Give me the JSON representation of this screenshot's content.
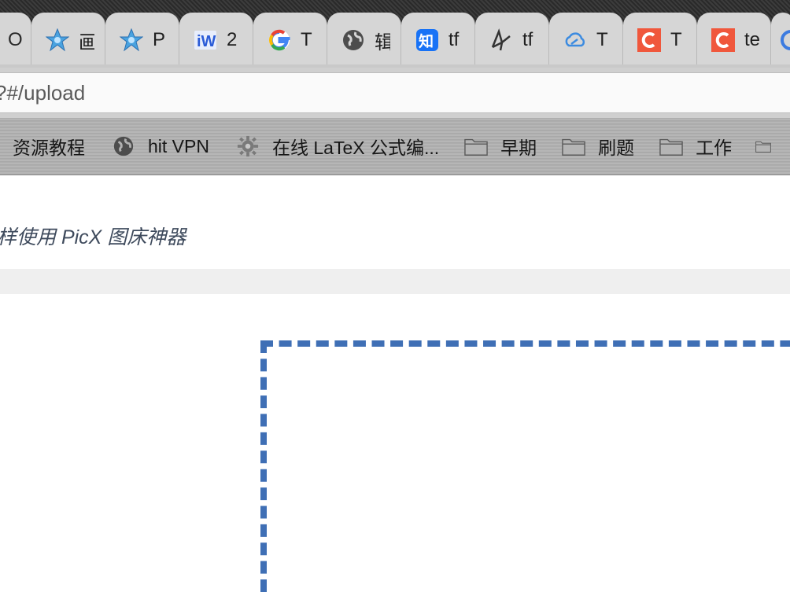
{
  "tabs": [
    {
      "label": "O",
      "icon": "partial-tab-icon"
    },
    {
      "label": "画",
      "icon": "star-logo-icon"
    },
    {
      "label": "P",
      "icon": "star-logo-icon"
    },
    {
      "label": "2",
      "icon": "w-logo-icon"
    },
    {
      "label": "T",
      "icon": "google-icon"
    },
    {
      "label": "辑",
      "icon": "globe-icon"
    },
    {
      "label": "tf",
      "icon": "zhihu-icon"
    },
    {
      "label": "tf",
      "icon": "sketch-logo-icon"
    },
    {
      "label": "T",
      "icon": "cloud-icon"
    },
    {
      "label": "T",
      "icon": "c-logo-icon"
    },
    {
      "label": "te",
      "icon": "c-logo-icon"
    }
  ],
  "address": {
    "text": "?#/upload"
  },
  "bookmarks": [
    {
      "label": "资源教程",
      "icon": "none"
    },
    {
      "label": "hit VPN",
      "icon": "globe-icon"
    },
    {
      "label": "在线 LaTeX 公式编...",
      "icon": "gear-icon"
    },
    {
      "label": "早期",
      "icon": "folder-icon"
    },
    {
      "label": "刷题",
      "icon": "folder-icon"
    },
    {
      "label": "工作",
      "icon": "folder-icon"
    }
  ],
  "page": {
    "slogan": "样使用 PicX 图床神器"
  },
  "colors": {
    "dropzone_border": "#3f6fb5",
    "zhihu_blue": "#1772f6",
    "c_logo_red": "#f0573c"
  }
}
